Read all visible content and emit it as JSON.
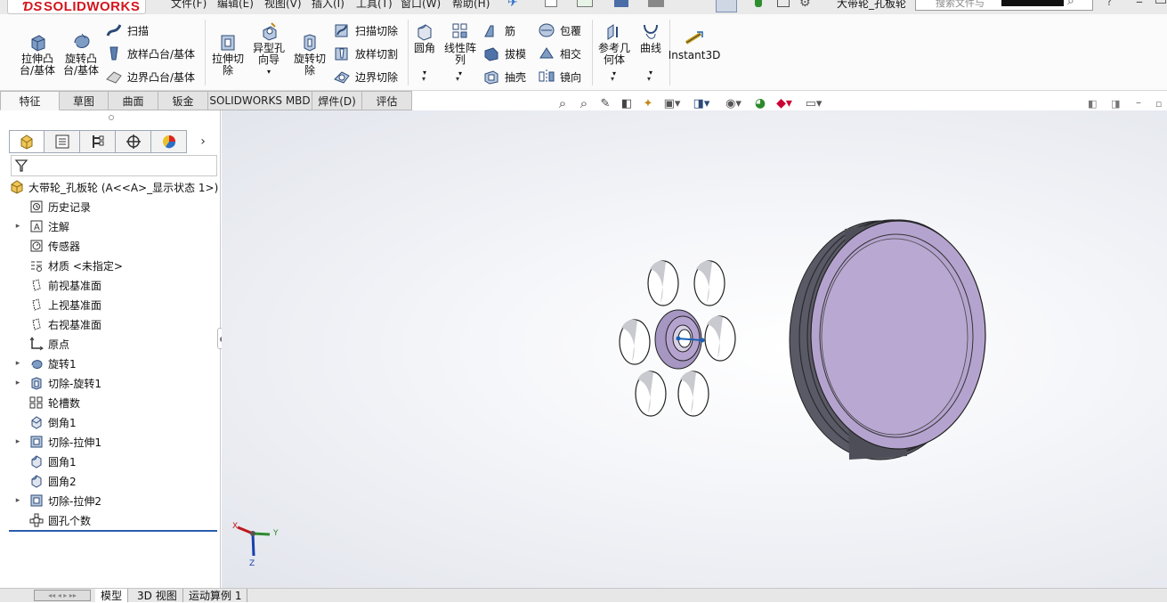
{
  "app": {
    "logo_text": "SOLIDWORKS",
    "brand_color": "#d2161e"
  },
  "menu": [
    "文件(F)",
    "编辑(E)",
    "视图(V)",
    "插入(I)",
    "工具(T)",
    "窗口(W)",
    "帮助(H)"
  ],
  "document_title": "大带轮_孔板轮",
  "search": {
    "placeholder": "搜索文件与"
  },
  "ribbon": {
    "extrude_boss": "拉伸凸\n台/基体",
    "revolve_boss": "旋转凸\n台/基体",
    "sweep": "扫描",
    "loft": "放样凸台/基体",
    "boundary": "边界凸台/基体",
    "extrude_cut": "拉伸切\n除",
    "hole_wizard": "异型孔\n向导",
    "revolve_cut": "旋转切\n除",
    "swept_cut": "扫描切除",
    "lofted_cut": "放样切割",
    "boundary_cut": "边界切除",
    "fillet": "圆角",
    "linear_pattern": "线性阵\n列",
    "rib": "筋",
    "draft": "拔模",
    "shell": "抽壳",
    "wrap": "包覆",
    "intersect": "相交",
    "mirror": "镜向",
    "ref_geometry": "参考几\n何体",
    "curves": "曲线",
    "instant3d": "Instant3D"
  },
  "command_tabs": [
    "特征",
    "草图",
    "曲面",
    "钣金",
    "SOLIDWORKS MBD",
    "焊件(D)",
    "评估"
  ],
  "feature_tree": {
    "root": "大带轮_孔板轮  (A<<A>_显示状态 1>)",
    "items": [
      {
        "label": "历史记录",
        "icon": "history-icon",
        "expand": false
      },
      {
        "label": "注解",
        "icon": "annotation-icon",
        "expand": true
      },
      {
        "label": "传感器",
        "icon": "sensor-icon",
        "expand": false
      },
      {
        "label": "材质 <未指定>",
        "icon": "material-icon",
        "expand": false
      },
      {
        "label": "前视基准面",
        "icon": "plane-icon",
        "expand": false
      },
      {
        "label": "上视基准面",
        "icon": "plane-icon",
        "expand": false
      },
      {
        "label": "右视基准面",
        "icon": "plane-icon",
        "expand": false
      },
      {
        "label": "原点",
        "icon": "origin-icon",
        "expand": false
      },
      {
        "label": "旋转1",
        "icon": "revolve-icon",
        "expand": true
      },
      {
        "label": "切除-旋转1",
        "icon": "revolve-cut-icon",
        "expand": true
      },
      {
        "label": "轮槽数",
        "icon": "pattern-icon",
        "expand": false
      },
      {
        "label": "倒角1",
        "icon": "chamfer-icon",
        "expand": false
      },
      {
        "label": "切除-拉伸1",
        "icon": "extrude-cut-icon",
        "expand": true
      },
      {
        "label": "圆角1",
        "icon": "fillet-icon",
        "expand": false
      },
      {
        "label": "圆角2",
        "icon": "fillet-icon",
        "expand": false
      },
      {
        "label": "切除-拉伸2",
        "icon": "extrude-cut-icon",
        "expand": true
      },
      {
        "label": "圆孔个数",
        "icon": "circular-pattern-icon",
        "expand": false
      }
    ]
  },
  "triad": {
    "x": "X",
    "y": "Y",
    "z": "Z"
  },
  "bottom_tabs": [
    "模型",
    "3D 视图",
    "运动算例 1"
  ],
  "colors": {
    "part": "#b5a3cf",
    "part_dark": "#5a5a66",
    "accent": "#1a5fb4"
  }
}
